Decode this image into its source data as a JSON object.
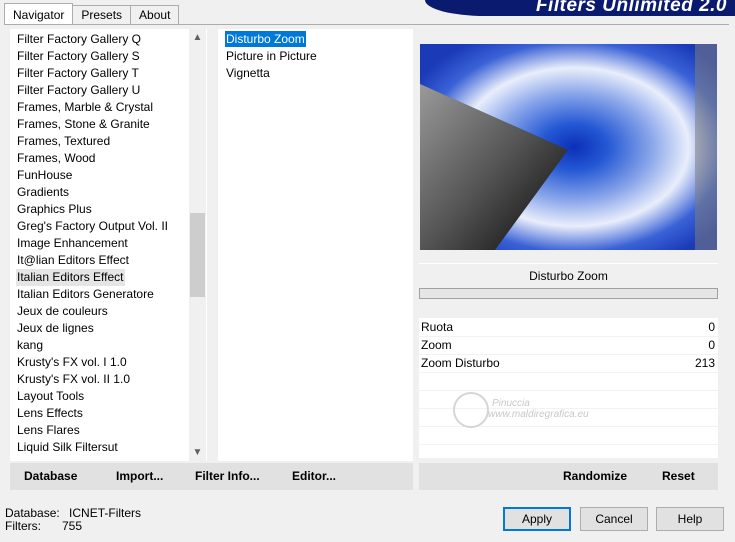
{
  "tabs": [
    "Navigator",
    "Presets",
    "About"
  ],
  "banner_title": "Filters Unlimited 2.0",
  "filter_categories": [
    "Filter Factory Gallery Q",
    "Filter Factory Gallery S",
    "Filter Factory Gallery T",
    "Filter Factory Gallery U",
    "Frames, Marble & Crystal",
    "Frames, Stone & Granite",
    "Frames, Textured",
    "Frames, Wood",
    "FunHouse",
    "Gradients",
    "Graphics Plus",
    "Greg's Factory Output Vol. II",
    "Image Enhancement",
    "It@lian Editors Effect",
    "Italian Editors Effect",
    "Italian Editors Generatore",
    "Jeux de couleurs",
    "Jeux de lignes",
    "kang",
    "Krusty's FX vol. I 1.0",
    "Krusty's FX vol. II 1.0",
    "Layout Tools",
    "Lens Effects",
    "Lens Flares",
    "Liquid Silk Filtersut"
  ],
  "highlighted_category": "Italian Editors Effect",
  "effects": [
    "Disturbo Zoom",
    "Picture in Picture",
    "Vignetta"
  ],
  "selected_effect": "Disturbo Zoom",
  "effect_name": "Disturbo Zoom",
  "parameters": [
    {
      "label": "Ruota",
      "value": "0"
    },
    {
      "label": "Zoom",
      "value": "0"
    },
    {
      "label": "Zoom Disturbo",
      "value": "213"
    }
  ],
  "watermark": [
    "Pinuccia",
    "www.maldiregrafica.eu"
  ],
  "left_buttons": {
    "database": "Database",
    "import": "Import...",
    "filter_info": "Filter Info...",
    "editor": "Editor..."
  },
  "right_buttons": {
    "randomize": "Randomize",
    "reset": "Reset"
  },
  "status": {
    "database_label": "Database:",
    "database_value": "ICNET-Filters",
    "filters_label": "Filters:",
    "filters_value": "755"
  },
  "dialog_buttons": {
    "apply": "Apply",
    "cancel": "Cancel",
    "help": "Help"
  },
  "colors": {
    "accent": "#0078d7",
    "banner": "#0a1a6e",
    "preview_blue": "#1c46c8"
  }
}
